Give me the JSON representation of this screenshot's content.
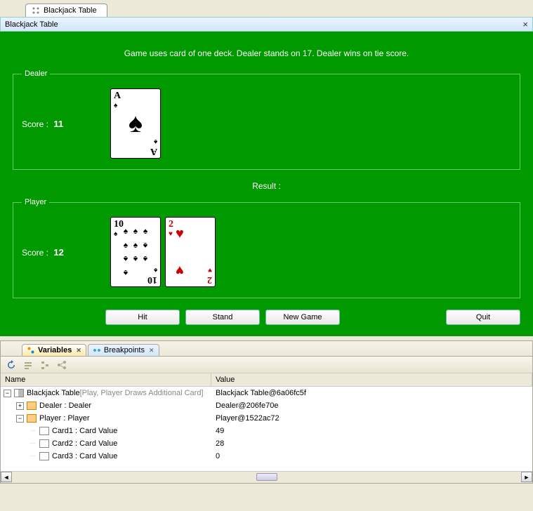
{
  "topTab": {
    "label": "Blackjack Table"
  },
  "window": {
    "title": "Blackjack Table"
  },
  "game": {
    "rules": "Game uses card of one deck. Dealer stands on 17. Dealer wins on tie score.",
    "dealer": {
      "legend": "Dealer",
      "scoreLabel": "Score :",
      "score": "11",
      "cards": [
        {
          "rank": "A",
          "suit": "♠",
          "color": "black",
          "layout": "center"
        }
      ]
    },
    "resultLabel": "Result :",
    "resultValue": "",
    "player": {
      "legend": "Player",
      "scoreLabel": "Score :",
      "score": "12",
      "cards": [
        {
          "rank": "10",
          "suit": "♠",
          "color": "black",
          "layout": "pips10"
        },
        {
          "rank": "2",
          "suit": "♥",
          "color": "red",
          "layout": "pips2"
        }
      ]
    },
    "buttons": {
      "hit": "Hit",
      "stand": "Stand",
      "newGame": "New Game",
      "quit": "Quit"
    }
  },
  "lower": {
    "tabs": {
      "variables": "Variables",
      "breakpoints": "Breakpoints"
    },
    "columns": {
      "name": "Name",
      "value": "Value"
    },
    "rows": [
      {
        "depth": 0,
        "expand": "-",
        "icon": "play",
        "name": "Blackjack Table",
        "suffix": " [Play, Player Draws Additional Card]",
        "value": "Blackjack Table@6a06fc5f"
      },
      {
        "depth": 1,
        "expand": "+",
        "icon": "obj",
        "name": "Dealer : Dealer",
        "value": "Dealer@206fe70e"
      },
      {
        "depth": 1,
        "expand": "-",
        "icon": "obj",
        "name": "Player : Player",
        "value": "Player@1522ac72"
      },
      {
        "depth": 2,
        "expand": "",
        "icon": "field",
        "name": "Card1 : Card Value",
        "value": "49"
      },
      {
        "depth": 2,
        "expand": "",
        "icon": "field",
        "name": "Card2 : Card Value",
        "value": "28"
      },
      {
        "depth": 2,
        "expand": "",
        "icon": "field",
        "name": "Card3 : Card Value",
        "value": "0"
      }
    ]
  }
}
